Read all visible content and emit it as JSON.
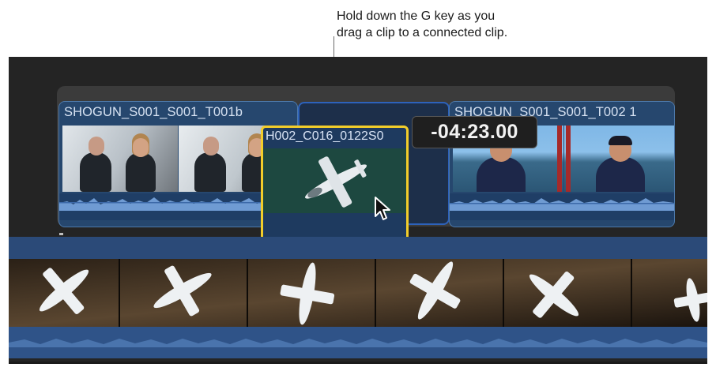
{
  "callout": {
    "line1": "Hold down the G key as you",
    "line2": "drag a clip to a connected clip."
  },
  "timeline": {
    "connected_clips": [
      {
        "name": "SHOGUN_S001_S001_T001b"
      },
      {
        "name": "SHOGUN_S001_S001_T002 1"
      }
    ],
    "dragged_clip": {
      "name": "H002_C016_0122S0"
    },
    "timecode": "-04:23.00",
    "cursor_icon": "arrow-pointer-icon"
  },
  "colors": {
    "timeline_background": "#242424",
    "clip_blue": "#26476e",
    "selection_outline": "#2d62bb",
    "drag_highlight": "#f2cd2a"
  }
}
